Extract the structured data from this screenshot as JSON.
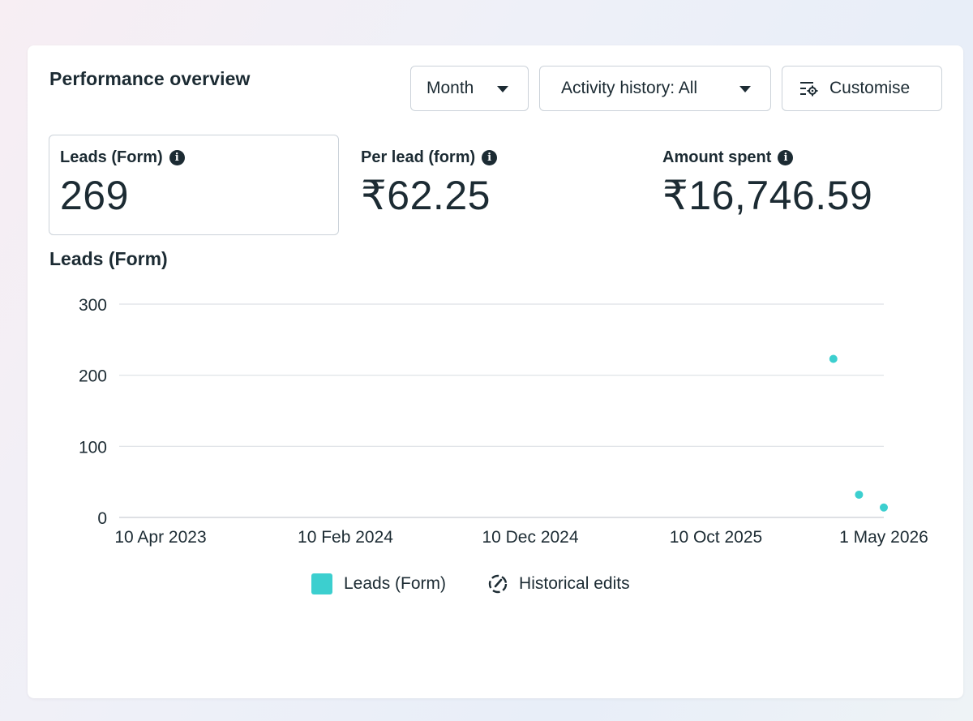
{
  "header": {
    "title": "Performance overview",
    "month_label": "Month",
    "activity_label": "Activity history: All",
    "customise_label": "Customise"
  },
  "metrics": [
    {
      "label": "Leads (Form)",
      "value": "269",
      "selected": true
    },
    {
      "label": "Per lead (form)",
      "value": "₹62.25",
      "selected": false
    },
    {
      "label": "Amount spent",
      "value": "₹16,746.59",
      "selected": false
    }
  ],
  "chart_title": "Leads (Form)",
  "legend": {
    "series_label": "Leads (Form)",
    "edits_label": "Historical edits"
  },
  "colors": {
    "accent": "#3ccfcf",
    "text": "#1c2b33",
    "gridline": "#dde1e5"
  },
  "icons": {
    "dropdown": "caret-down-icon",
    "customise": "sliders-gear-icon",
    "info": "info-icon",
    "historical_edits": "dashed-circle-edit-icon"
  },
  "chart_data": {
    "type": "scatter",
    "title": "Leads (Form)",
    "xlabel": "",
    "ylabel": "",
    "ylim": [
      0,
      300
    ],
    "yticks": [
      0,
      100,
      200,
      300
    ],
    "xticks": [
      "10 Apr 2023",
      "10 Feb 2024",
      "10 Dec 2024",
      "10 Oct 2025",
      "1 May 2026"
    ],
    "grid": true,
    "legend_position": "bottom",
    "series": [
      {
        "name": "Leads (Form)",
        "points": [
          {
            "x": "2026-03-01",
            "y": 223
          },
          {
            "x": "2026-04-01",
            "y": 32
          },
          {
            "x": "2026-05-01",
            "y": 14
          }
        ]
      }
    ]
  }
}
